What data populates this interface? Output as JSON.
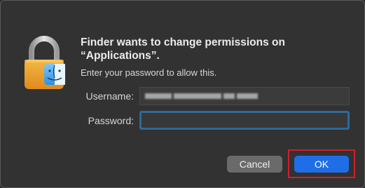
{
  "dialog": {
    "title": "Finder wants to change permissions on “Applications”.",
    "message": "Enter your password to allow this.",
    "username_label": "Username:",
    "username_value": "",
    "password_label": "Password:",
    "password_value": "",
    "cancel_label": "Cancel",
    "ok_label": "OK",
    "icon": "lock-with-finder-icon",
    "accent_color": "#1f6ee8",
    "highlight_color": "#d21f2a"
  }
}
